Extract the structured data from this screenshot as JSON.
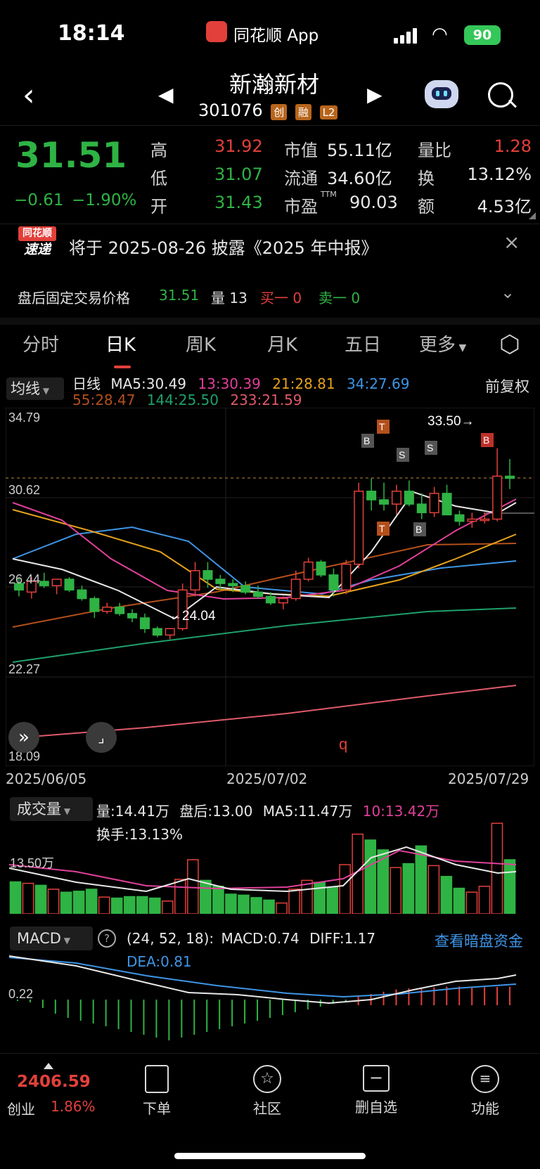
{
  "status_bar": {
    "time": "18:14",
    "app_label": "同花顺 App",
    "battery": "90"
  },
  "header": {
    "stock_name": "新瀚新材",
    "stock_code": "301076",
    "badges": [
      "创",
      "融",
      "L2"
    ]
  },
  "quote": {
    "price": "31.51",
    "change": "−0.61",
    "change_pct": "−1.90%",
    "high_label": "高",
    "high": "31.92",
    "low_label": "低",
    "low": "31.07",
    "open_label": "开",
    "open": "31.43",
    "mktcap_label": "市值",
    "mktcap": "55.11亿",
    "float_label": "流通",
    "float": "34.60亿",
    "pe_label": "市盈",
    "pe_sup": "TTM",
    "pe": "90.03",
    "volratio_label": "量比",
    "volratio": "1.28",
    "turnover_label": "换",
    "turnover": "13.12%",
    "amount_label": "额",
    "amount": "4.53亿"
  },
  "notice": {
    "logo_top": "同花顺",
    "logo_bottom": "速递",
    "text": "将于 2025-08-26 披露《2025 年中报》"
  },
  "after_hours": {
    "label": "盘后固定交易价格",
    "price": "31.51",
    "vol_label": "量 13",
    "buy": "买一 0",
    "sell": "卖一 0"
  },
  "tabs": [
    "分时",
    "日K",
    "周K",
    "月K",
    "五日",
    "更多"
  ],
  "active_tab": "日K",
  "ma_legend": {
    "selector": "均线",
    "line_label": "日线",
    "ma5": "MA5:30.49",
    "ma13": "13:30.39",
    "ma21": "21:28.81",
    "ma34": "34:27.69",
    "ma55": "55:28.47",
    "ma144": "144:25.50",
    "ma233": "233:21.59",
    "adjust": "前复权"
  },
  "kline": {
    "y_labels": [
      "34.79",
      "30.62",
      "26.44",
      "22.27",
      "18.09"
    ],
    "x_labels": [
      "2025/06/05",
      "2025/07/02",
      "2025/07/29"
    ],
    "high_marker": "33.50→",
    "low_marker": "←24.04"
  },
  "volume": {
    "selector": "成交量",
    "vol": "量:14.41万",
    "after": "盘后:13.00",
    "ma5": "MA5:11.47万",
    "ma10": "10:13.42万",
    "turnover": "换手:13.13%",
    "y_label": "13.50万"
  },
  "macd": {
    "selector": "MACD",
    "params": "(24, 52, 18):",
    "macd": "MACD:0.74",
    "diff": "DIFF:1.17",
    "dea": "DEA:0.81",
    "link": "查看暗盘资金",
    "y_label": "0.22"
  },
  "bottom_nav": {
    "index_value": "2406.59",
    "index_name": "创业",
    "index_pct": "1.86%",
    "items": [
      "下单",
      "社区",
      "删自选",
      "功能"
    ]
  },
  "chart_data": [
    {
      "type": "candlestick",
      "title": "日K",
      "x": [
        "2025/06/05",
        "2025/07/02",
        "2025/07/29"
      ],
      "ylim": [
        18.09,
        34.79
      ],
      "ohlc": [
        [
          26.6,
          26.9,
          26.0,
          26.3
        ],
        [
          26.2,
          26.9,
          25.9,
          26.7
        ],
        [
          26.7,
          27.1,
          26.4,
          26.5
        ],
        [
          26.5,
          26.8,
          26.1,
          26.8
        ],
        [
          26.8,
          26.9,
          26.2,
          26.3
        ],
        [
          26.3,
          26.5,
          25.8,
          25.9
        ],
        [
          25.9,
          26.0,
          25.0,
          25.3
        ],
        [
          25.3,
          25.7,
          25.2,
          25.5
        ],
        [
          25.5,
          25.7,
          25.1,
          25.2
        ],
        [
          25.2,
          25.4,
          24.8,
          25.0
        ],
        [
          25.0,
          25.2,
          24.3,
          24.5
        ],
        [
          24.5,
          24.6,
          24.1,
          24.2
        ],
        [
          24.2,
          24.4,
          24.0,
          24.5
        ],
        [
          24.5,
          26.6,
          24.4,
          26.3
        ],
        [
          26.3,
          27.6,
          26.0,
          27.2
        ],
        [
          27.2,
          27.6,
          26.4,
          26.8
        ],
        [
          26.8,
          27.0,
          26.3,
          26.6
        ],
        [
          26.6,
          26.8,
          26.2,
          26.5
        ],
        [
          26.5,
          26.7,
          26.1,
          26.2
        ],
        [
          26.2,
          26.5,
          25.9,
          26.0
        ],
        [
          26.0,
          26.2,
          25.6,
          25.7
        ],
        [
          25.7,
          26.0,
          25.4,
          25.9
        ],
        [
          25.9,
          27.2,
          25.8,
          26.8
        ],
        [
          26.8,
          27.8,
          26.7,
          27.6
        ],
        [
          27.6,
          27.7,
          26.9,
          27.0
        ],
        [
          27.0,
          27.3,
          26.0,
          26.3
        ],
        [
          26.3,
          27.7,
          26.1,
          27.5
        ],
        [
          27.5,
          31.3,
          27.3,
          30.9
        ],
        [
          30.9,
          31.5,
          30.0,
          30.5
        ],
        [
          30.5,
          31.3,
          30.0,
          30.3
        ],
        [
          30.3,
          31.2,
          29.8,
          30.9
        ],
        [
          30.9,
          31.4,
          30.2,
          30.3
        ],
        [
          30.3,
          30.8,
          29.6,
          29.9
        ],
        [
          29.9,
          31.1,
          29.7,
          30.8
        ],
        [
          30.8,
          31.2,
          29.8,
          29.8
        ],
        [
          29.8,
          30.0,
          29.3,
          29.5
        ],
        [
          29.5,
          29.9,
          29.2,
          29.6
        ],
        [
          29.6,
          29.9,
          29.4,
          29.6
        ],
        [
          29.6,
          32.9,
          29.5,
          31.6
        ],
        [
          31.6,
          32.4,
          31.0,
          31.5
        ]
      ]
    },
    {
      "type": "bar",
      "title": "成交量",
      "values": [
        6.5,
        6.2,
        5.8,
        5.0,
        4.4,
        4.6,
        5.0,
        3.4,
        3.2,
        3.5,
        3.5,
        3.2,
        2.6,
        7.0,
        11.0,
        6.8,
        5.6,
        4.0,
        3.8,
        3.3,
        2.8,
        2.2,
        5.0,
        6.8,
        6.4,
        5.4,
        10.0,
        16.2,
        15.0,
        13.0,
        9.4,
        10.2,
        13.8,
        9.8,
        7.6,
        5.2,
        4.4,
        5.6,
        18.4,
        11.0
      ]
    },
    {
      "type": "bar",
      "title": "MACD",
      "values": [
        -0.05,
        -0.1,
        -0.3,
        -0.5,
        -0.65,
        -0.75,
        -0.85,
        -0.95,
        -1.05,
        -1.15,
        -1.25,
        -1.35,
        -1.45,
        -1.35,
        -1.25,
        -1.15,
        -1.05,
        -0.95,
        -0.85,
        -0.75,
        -0.65,
        -0.55,
        -0.45,
        -0.35,
        -0.25,
        -0.15,
        -0.05,
        0.12,
        0.2,
        0.28,
        0.36,
        0.4,
        0.42,
        0.44,
        0.46,
        0.47,
        0.45,
        0.44,
        0.45,
        0.46
      ]
    }
  ]
}
